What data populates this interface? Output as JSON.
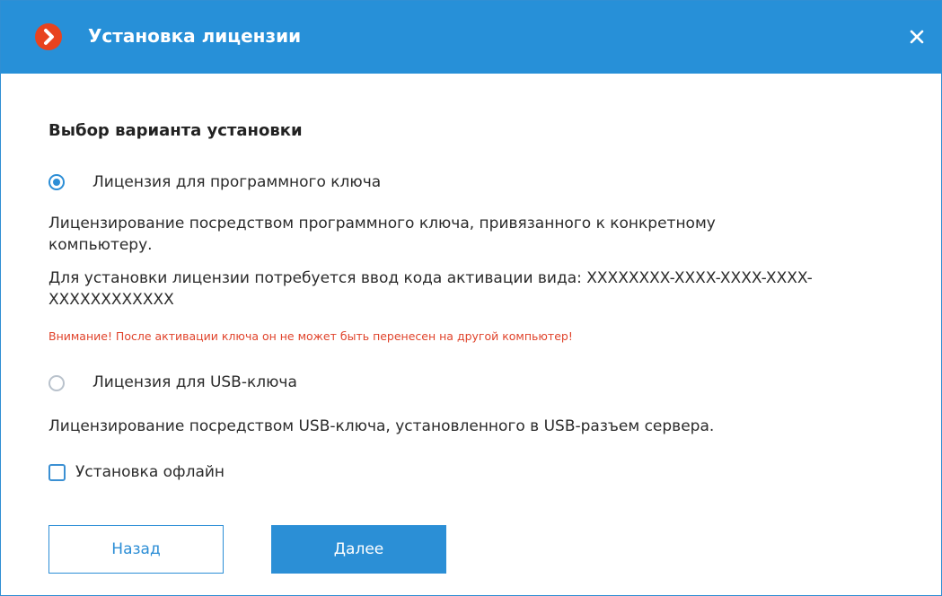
{
  "window": {
    "title": "Установка лицензии",
    "accent_color": "#2790d8",
    "app_icon": "chevron-right-logo-icon",
    "close_icon": "close-icon"
  },
  "main": {
    "section_title": "Выбор варианта установки",
    "options": [
      {
        "label": "Лицензия для программного ключа",
        "selected": true,
        "description_lines": [
          "Лицензирование посредством программного ключа, привязанного к конкретному",
          "компьютеру.",
          "Для установки лицензии потребуется ввод кода активации вида: XXXXXXXX-XXXX-XXXX-XXXX-",
          "XXXXXXXXXXXX"
        ],
        "warning": "Внимание! После активации ключа он не может быть перенесен на другой компьютер!"
      },
      {
        "label": "Лицензия для USB-ключа",
        "selected": false,
        "description_lines": [
          "Лицензирование посредством USB-ключа, установленного в USB-разъем сервера."
        ]
      }
    ],
    "offline": {
      "label": "Установка офлайн",
      "checked": false
    }
  },
  "buttons": {
    "back_label": "Назад",
    "next_label": "Далее"
  },
  "colors": {
    "warning": "#e0432b",
    "primary": "#2b8fd6"
  }
}
